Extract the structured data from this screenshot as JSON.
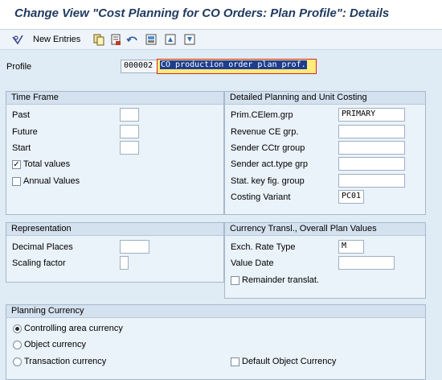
{
  "header": {
    "title": "Change View \"Cost Planning for CO Orders: Plan Profile\": Details"
  },
  "toolbar": {
    "new_entries_label": "New Entries",
    "icons": [
      "glasses-icon",
      "copy-icon",
      "save-icon",
      "undo-icon",
      "transport-icon",
      "first-entry-icon",
      "next-entry-icon"
    ]
  },
  "profile": {
    "label": "Profile",
    "code": "000002",
    "description": "CO production order plan prof."
  },
  "time_frame": {
    "title": "Time Frame",
    "past_label": "Past",
    "past_value": "",
    "future_label": "Future",
    "future_value": "",
    "start_label": "Start",
    "start_value": "",
    "total_values_label": "Total values",
    "total_values_checked": true,
    "annual_values_label": "Annual Values",
    "annual_values_checked": false
  },
  "detailed_planning": {
    "title": "Detailed Planning and Unit Costing",
    "prim_celem_label": "Prim.CElem.grp",
    "prim_celem_value": "PRIMARY",
    "revenue_label": "Revenue CE grp.",
    "revenue_value": "",
    "sender_cctr_label": "Sender CCtr group",
    "sender_cctr_value": "",
    "sender_act_label": "Sender act.type grp",
    "sender_act_value": "",
    "stat_key_label": "Stat. key fig. group",
    "stat_key_value": "",
    "costing_variant_label": "Costing Variant",
    "costing_variant_value": "PC01"
  },
  "representation": {
    "title": "Representation",
    "decimal_places_label": "Decimal Places",
    "decimal_places_value": "",
    "scaling_factor_label": "Scaling factor",
    "scaling_factor_value": ""
  },
  "currency_transl": {
    "title": "Currency Transl., Overall Plan Values",
    "exch_rate_label": "Exch. Rate Type",
    "exch_rate_value": "M",
    "value_date_label": "Value Date",
    "value_date_value": "",
    "remainder_label": "Remainder translat.",
    "remainder_checked": false
  },
  "planning_currency": {
    "title": "Planning Currency",
    "options": [
      "Controlling area currency",
      "Object currency",
      "Transaction currency"
    ],
    "selected": "Controlling area currency",
    "default_object_label": "Default Object Currency",
    "default_object_checked": false
  }
}
